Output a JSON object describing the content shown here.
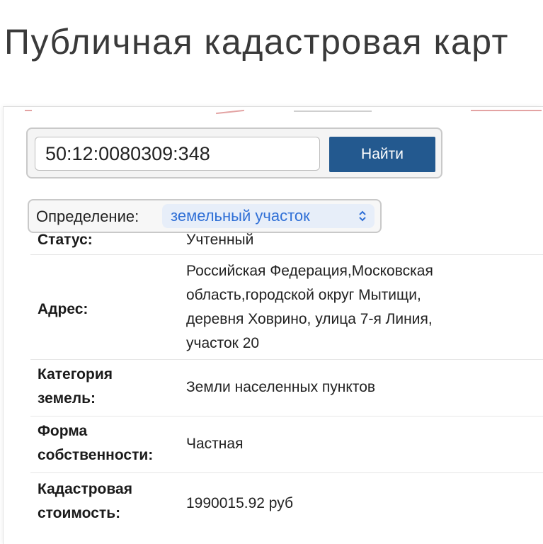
{
  "page": {
    "title": "Публичная кадастровая карт"
  },
  "search": {
    "value": "50:12:0080309:348",
    "button_label": "Найти"
  },
  "definition": {
    "label": "Определение:",
    "selected": "земельный участок"
  },
  "details": {
    "status": {
      "label": "Статус:",
      "value": "Учтенный"
    },
    "address": {
      "label": "Адрес:",
      "lines": [
        "Российская Федерация,Московская",
        "область,городской округ Мытищи,",
        "деревня Ховрино, улица 7-я Линия,",
        "участок 20"
      ]
    },
    "land_category": {
      "label_lines": [
        "Категория",
        "земель:"
      ],
      "value": "Земли населенных пунктов"
    },
    "ownership": {
      "label_lines": [
        "Форма",
        "собственности:"
      ],
      "value": "Частная"
    },
    "cadastral_value": {
      "label_lines": [
        "Кадастровая",
        "стоимость:"
      ],
      "value": "1990015.92 руб"
    }
  },
  "colors": {
    "button": "#23598f",
    "select_text": "#2f6fd6",
    "select_bg": "#e7eef9"
  },
  "icons": {
    "select_arrows": "updown-chevron-icon"
  }
}
